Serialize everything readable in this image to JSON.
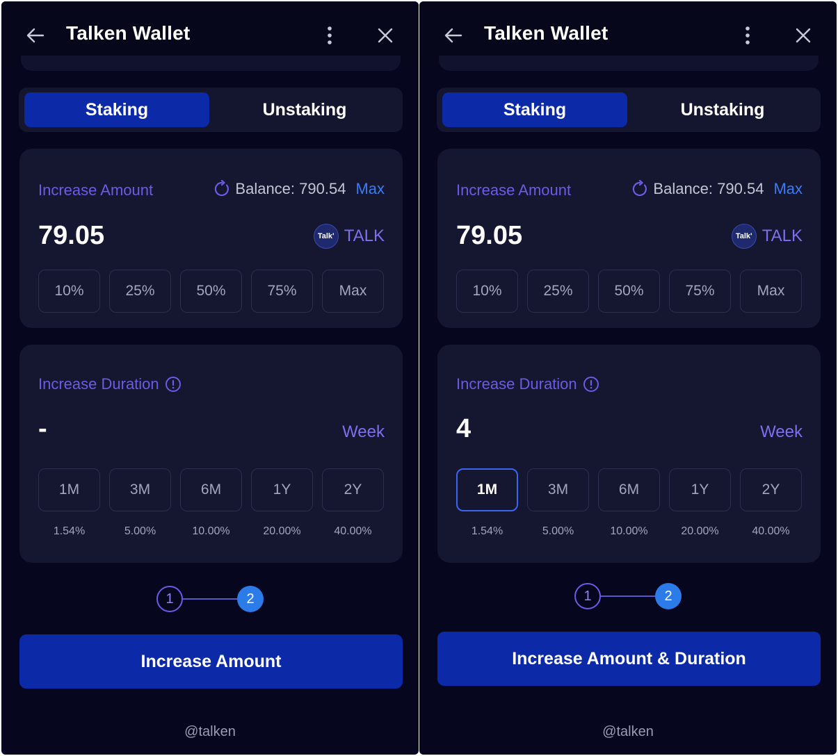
{
  "panels": [
    {
      "header": {
        "title": "Talken Wallet"
      },
      "tabs": {
        "staking": "Staking",
        "unstaking": "Unstaking"
      },
      "amount": {
        "label": "Increase Amount",
        "balance_text": "Balance: 790.54",
        "max_link": "Max",
        "value": "79.05",
        "token_logo_text": "Talk'",
        "token_symbol": "TALK",
        "chips": [
          "10%",
          "25%",
          "50%",
          "75%",
          "Max"
        ]
      },
      "duration": {
        "label": "Increase Duration",
        "value": "-",
        "unit": "Week",
        "chips": [
          "1M",
          "3M",
          "6M",
          "1Y",
          "2Y"
        ],
        "selected_chip": null,
        "rates": [
          "1.54%",
          "5.00%",
          "10.00%",
          "20.00%",
          "40.00%"
        ]
      },
      "stepper": {
        "step1": "1",
        "step2": "2",
        "active_step": 2
      },
      "cta": "Increase Amount",
      "footer": "@talken"
    },
    {
      "header": {
        "title": "Talken Wallet"
      },
      "tabs": {
        "staking": "Staking",
        "unstaking": "Unstaking"
      },
      "amount": {
        "label": "Increase Amount",
        "balance_text": "Balance: 790.54",
        "max_link": "Max",
        "value": "79.05",
        "token_logo_text": "Talk'",
        "token_symbol": "TALK",
        "chips": [
          "10%",
          "25%",
          "50%",
          "75%",
          "Max"
        ]
      },
      "duration": {
        "label": "Increase Duration",
        "value": "4",
        "unit": "Week",
        "chips": [
          "1M",
          "3M",
          "6M",
          "1Y",
          "2Y"
        ],
        "selected_chip": "1M",
        "rates": [
          "1.54%",
          "5.00%",
          "10.00%",
          "20.00%",
          "40.00%"
        ]
      },
      "stepper": {
        "step1": "1",
        "step2": "2",
        "active_step": 2
      },
      "cta": "Increase Amount & Duration",
      "footer": "@talken"
    }
  ],
  "colors": {
    "background": "#06061f",
    "card": "#15162f",
    "primary_button": "#0c2aa8",
    "accent_purple": "#6a5ce6",
    "link_blue": "#3c7cf0",
    "step_active": "#2b7be9"
  },
  "icons": [
    "back-arrow-icon",
    "kebab-menu-icon",
    "close-icon",
    "refresh-icon",
    "info-icon",
    "talk-token-logo"
  ]
}
